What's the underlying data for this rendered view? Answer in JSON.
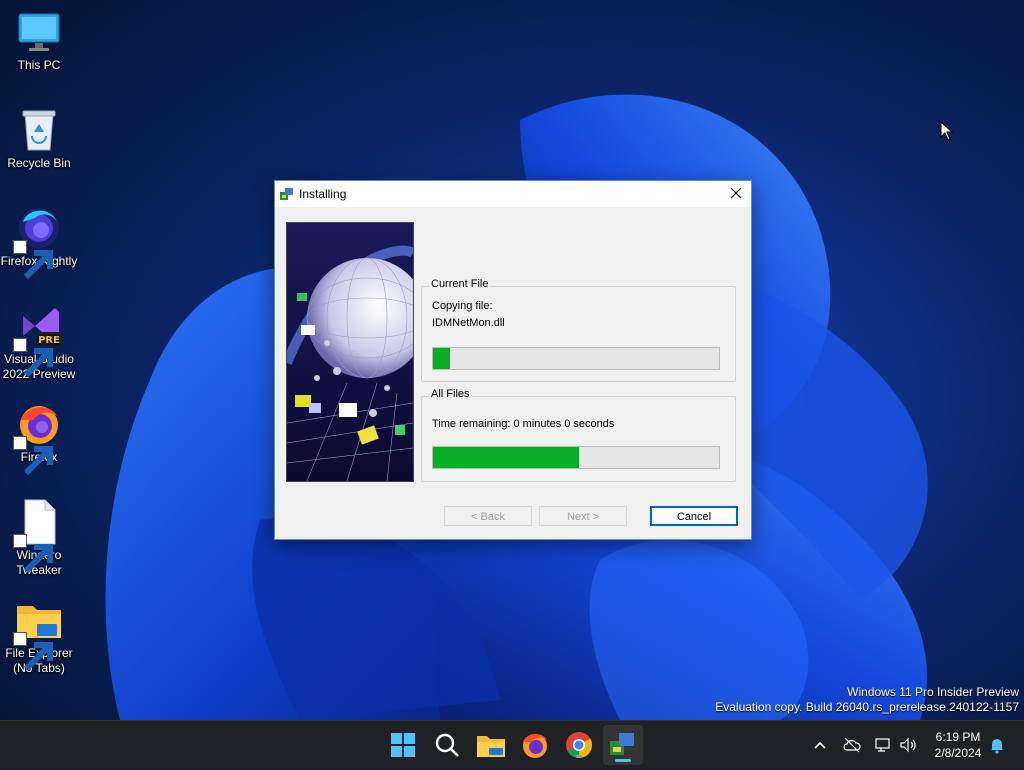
{
  "desktop": {
    "icons": [
      {
        "label": "This PC",
        "icon": "monitor-icon"
      },
      {
        "label": "Recycle Bin",
        "icon": "recycle-bin-icon"
      },
      {
        "label": "Firefox Nightly",
        "icon": "firefox-nightly-icon"
      },
      {
        "label": "Visual Studio 2022 Preview",
        "icon": "visual-studio-icon",
        "badge": "PRE"
      },
      {
        "label": "Firefox",
        "icon": "firefox-icon"
      },
      {
        "label": "Winaero Tweaker",
        "icon": "document-icon"
      },
      {
        "label": "File Explorer (No Tabs)",
        "icon": "folder-icon"
      }
    ],
    "watermark": {
      "line1": "Windows 11 Pro Insider Preview",
      "line2": "Evaluation copy. Build 26040.rs_prerelease.240122-1157"
    }
  },
  "dialog": {
    "title": "Installing",
    "current_file": {
      "group_label": "Current File",
      "status": "Copying file:",
      "filename": "IDMNetMon.dll",
      "progress": 0.06
    },
    "all_files": {
      "group_label": "All Files",
      "time_remaining": "Time remaining: 0 minutes 0 seconds",
      "progress": 0.51
    },
    "buttons": {
      "back": "< Back",
      "next": "Next >",
      "cancel": "Cancel"
    }
  },
  "taskbar": {
    "apps": [
      "start-icon",
      "search-icon",
      "file-explorer-icon",
      "firefox-icon",
      "chrome-icon",
      "installer-icon"
    ],
    "clock": {
      "time": "6:19 PM",
      "date": "2/8/2024"
    }
  },
  "colors": {
    "accent": "#0067c0",
    "progress": "#06b025",
    "taskbar": "#202124"
  }
}
